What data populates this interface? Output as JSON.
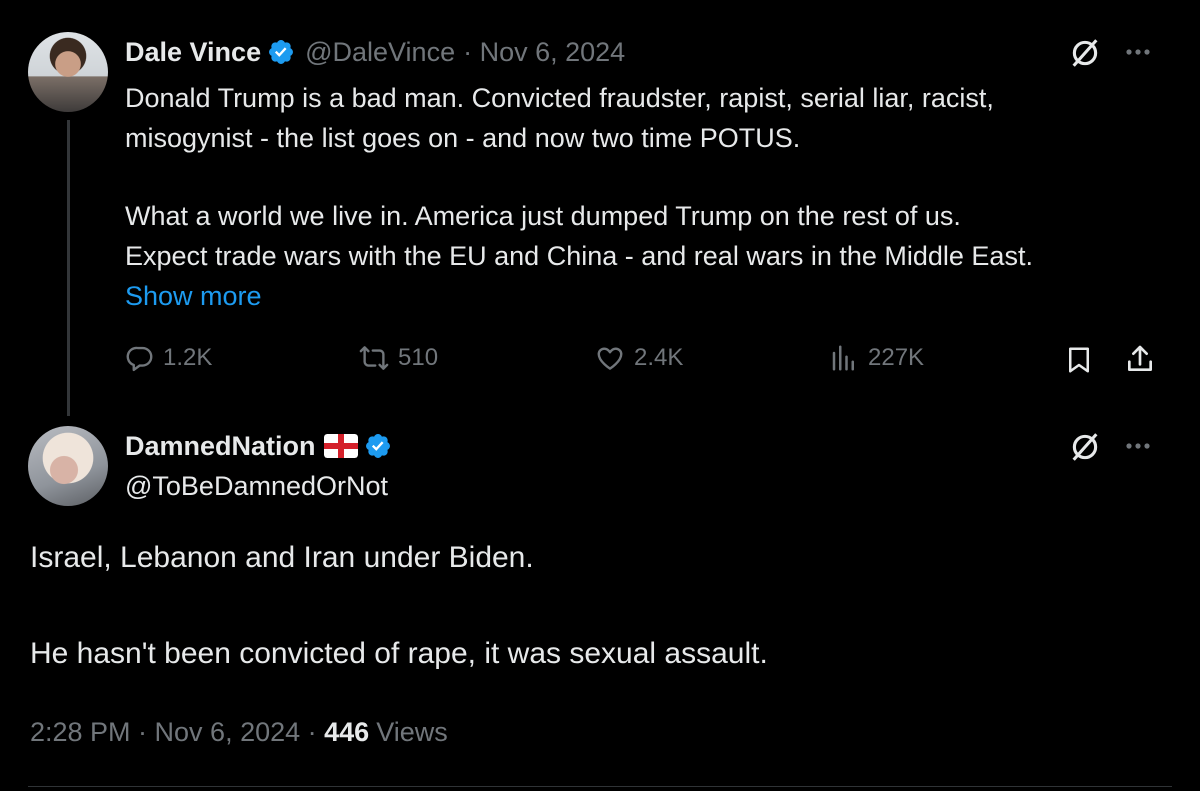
{
  "colors": {
    "background": "#000000",
    "text": "#e7e9ea",
    "muted": "#71767b",
    "link": "#1d9bf0",
    "verified": "#1d9bf0"
  },
  "original_tweet": {
    "name": "Dale Vince",
    "handle": "@DaleVince",
    "date": "· Nov 6, 2024",
    "lines": [
      "Donald Trump is a bad man. Convicted fraudster, rapist, serial liar, racist,",
      "misogynist - the list goes on - and now two time POTUS.",
      "What a world we live in. America just dumped Trump on the rest of us.",
      "Expect trade wars with the EU and China - and real wars in the Middle East."
    ],
    "show_more": "Show more",
    "stats": {
      "replies": "1.2K",
      "reposts": "510",
      "likes": "2.4K",
      "views": "227K"
    },
    "icons": [
      "grok-icon",
      "more-icon",
      "reply-icon",
      "repost-icon",
      "like-icon",
      "views-icon",
      "bookmark-icon",
      "share-icon"
    ]
  },
  "reply_tweet": {
    "name": "DamnedNation",
    "handle": "@ToBeDamnedOrNot",
    "flag": "england-flag",
    "lines": [
      "Israel, Lebanon and Iran under Biden.",
      "He hasn't been convicted of rape, it was sexual assault."
    ],
    "time": "2:28 PM · Nov 6, 2024 · ",
    "views_count": "446",
    "views_label": "Views"
  }
}
